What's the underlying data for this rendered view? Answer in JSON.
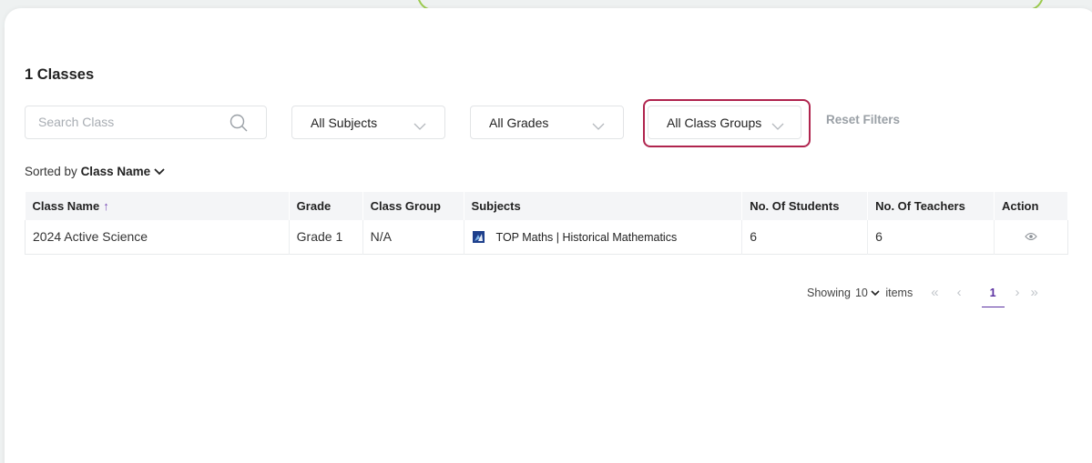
{
  "header": {
    "title": "1 Classes"
  },
  "filters": {
    "search_placeholder": "Search Class",
    "subjects": "All Subjects",
    "grades": "All Grades",
    "class_groups": "All Class Groups",
    "reset": "Reset Filters"
  },
  "sort": {
    "prefix": "Sorted by",
    "field": "Class Name"
  },
  "table": {
    "columns": [
      "Class Name",
      "Grade",
      "Class Group",
      "Subjects",
      "No. Of Students",
      "No. Of Teachers",
      "Action"
    ],
    "sort_indicator": "↑",
    "rows": [
      {
        "class_name": "2024 Active Science",
        "grade": "Grade 1",
        "class_group": "N/A",
        "subjects": "TOP Maths | Historical Mathematics",
        "students": "6",
        "teachers": "6"
      }
    ]
  },
  "pagination": {
    "showing": "Showing",
    "page_size": "10",
    "items": "items",
    "first": "«",
    "prev": "‹",
    "current": "1",
    "next": "›",
    "last": "»"
  },
  "colors": {
    "accent": "#5a2fa0",
    "highlight_border": "#b0244e",
    "top_highlight": "#9ccb4e"
  },
  "icons": {
    "search": "search-icon",
    "chevron": "chevron-down-icon",
    "subject": "subject-logo-icon",
    "view": "eye-icon"
  }
}
